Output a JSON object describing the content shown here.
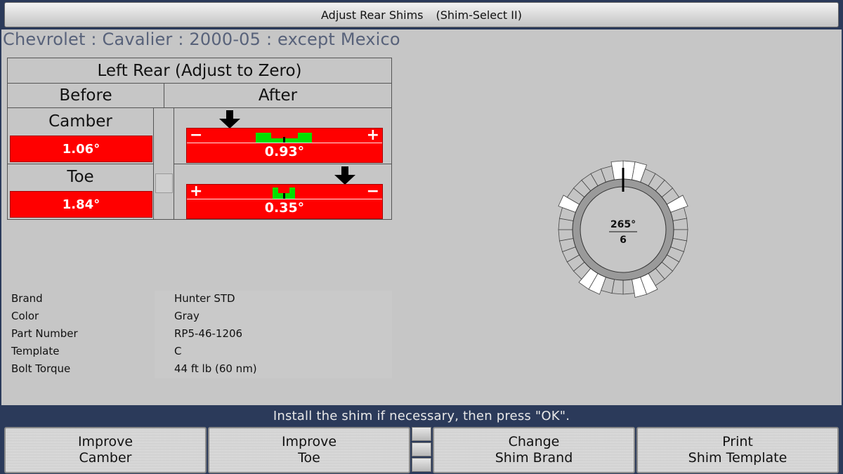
{
  "title": {
    "main": "Adjust Rear Shims",
    "sub": "(Shim-Select II)"
  },
  "vehicle": "Chevrolet : Cavalier : 2000-05 : except Mexico",
  "measurement": {
    "header": "Left Rear (Adjust to Zero)",
    "before_label": "Before",
    "after_label": "After",
    "camber": {
      "label": "Camber",
      "before": "1.06°",
      "after": "0.93°",
      "left_symbol": "−",
      "right_symbol": "+"
    },
    "toe": {
      "label": "Toe",
      "before": "1.84°",
      "after": "0.35°",
      "left_symbol": "+",
      "right_symbol": "−"
    }
  },
  "shim": {
    "angle": "265°",
    "position": "6"
  },
  "specs": [
    {
      "key": "Brand",
      "value": "Hunter STD"
    },
    {
      "key": "Color",
      "value": "Gray"
    },
    {
      "key": "Part Number",
      "value": "RP5-46-1206"
    },
    {
      "key": "Template",
      "value": "C"
    },
    {
      "key": "Bolt Torque",
      "value": "44 ft lb (60 nm)"
    }
  ],
  "status": "Install the shim if necessary, then press \"OK\".",
  "buttons": [
    {
      "line1": "Improve",
      "line2": "Camber"
    },
    {
      "line1": "Improve",
      "line2": "Toe"
    },
    {
      "line1": "Change",
      "line2": "Shim Brand"
    },
    {
      "line1": "Print",
      "line2": "Shim Template"
    }
  ],
  "colors": {
    "out_of_range": "#ff0000",
    "in_range": "#00e000",
    "background": "#c6c6c6",
    "frame": "#2b3a5a"
  }
}
